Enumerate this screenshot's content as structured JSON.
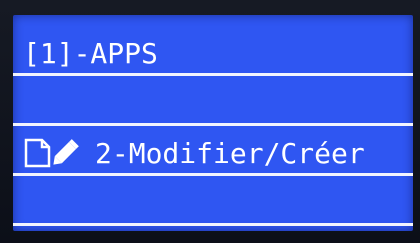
{
  "menu": {
    "title": "[1]-APPS",
    "items": [
      {
        "icon": "edit-document-icon",
        "label": "2-Modifier/Créer"
      }
    ]
  },
  "colors": {
    "screen_background": "#2f56f2",
    "text": "#ffffff",
    "separator": "#f2f4ff",
    "bezel": "#0e1320"
  }
}
